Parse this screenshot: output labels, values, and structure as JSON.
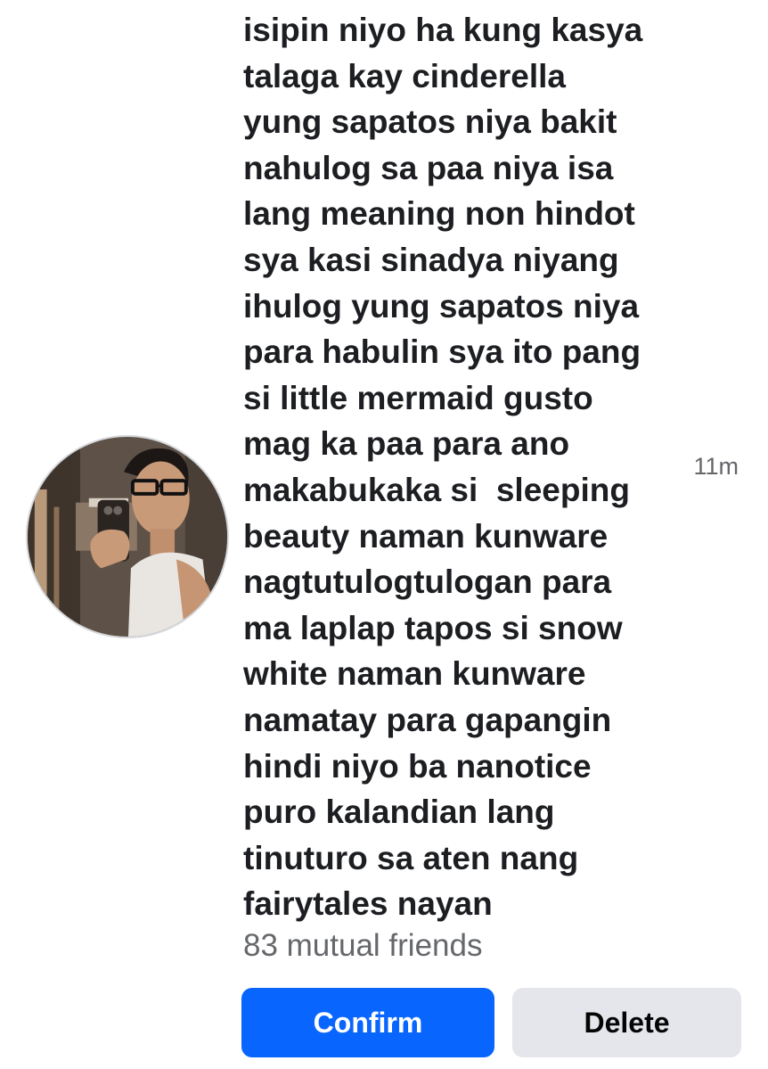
{
  "request": {
    "name_lines": [
      "isipin niyo ha kung kasya",
      "talaga kay cinderella",
      "yung sapatos niya bakit",
      "nahulog sa paa niya isa",
      "lang meaning non hindot",
      "sya kasi sinadya niyang",
      "ihulog yung sapatos niya",
      "para habulin sya ito pang",
      "si little mermaid gusto",
      "mag ka paa para ano",
      "makabukaka si  sleeping",
      "beauty naman kunware",
      "nagtutulogtulogan para",
      "ma laplap tapos si snow",
      "white naman kunware",
      "namatay para gapangin",
      "hindi niyo ba nanotice",
      "puro kalandian lang",
      "tinuturo sa aten nang",
      "fairytales nayan"
    ],
    "timestamp": "11m",
    "mutual_friends": "83 mutual friends",
    "confirm_label": "Confirm",
    "delete_label": "Delete",
    "avatar_icon": "profile-photo"
  },
  "colors": {
    "primary_text": "#1c1e21",
    "secondary_text": "#65676b",
    "confirm_bg": "#0866ff",
    "delete_bg": "#e4e6eb"
  }
}
